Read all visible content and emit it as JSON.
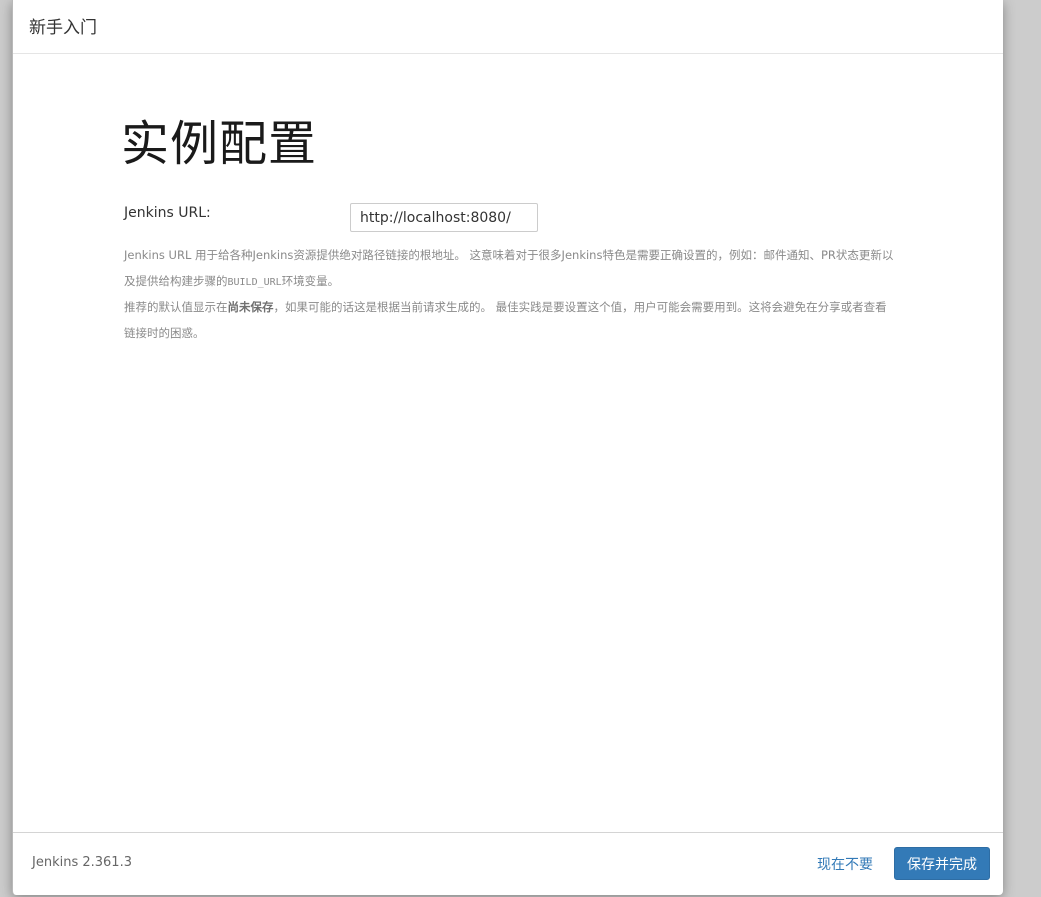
{
  "header": {
    "title": "新手入门"
  },
  "main": {
    "title": "实例配置",
    "url_label": "Jenkins URL:",
    "url_value": "http://localhost:8080/",
    "help": {
      "p1_before_code": "Jenkins URL 用于给各种Jenkins资源提供绝对路径链接的根地址。 这意味着对于很多Jenkins特色是需要正确设置的，例如：邮件通知、PR状态更新以及提供给构建步骤的",
      "p1_code": "BUILD_URL",
      "p1_after_code": "环境变量。",
      "p2_before_bold": "推荐的默认值显示在",
      "p2_bold": "尚未保存",
      "p2_after_bold": "，如果可能的话这是根据当前请求生成的。 最佳实践是要设置这个值，用户可能会需要用到。这将会避免在分享或者查看链接时的困惑。"
    }
  },
  "footer": {
    "version": "Jenkins 2.361.3",
    "skip_label": "现在不要",
    "save_label": "保存并完成"
  },
  "colors": {
    "primary": "#337ab7",
    "background": "#cccccc",
    "help_text": "#8a8a8a"
  }
}
